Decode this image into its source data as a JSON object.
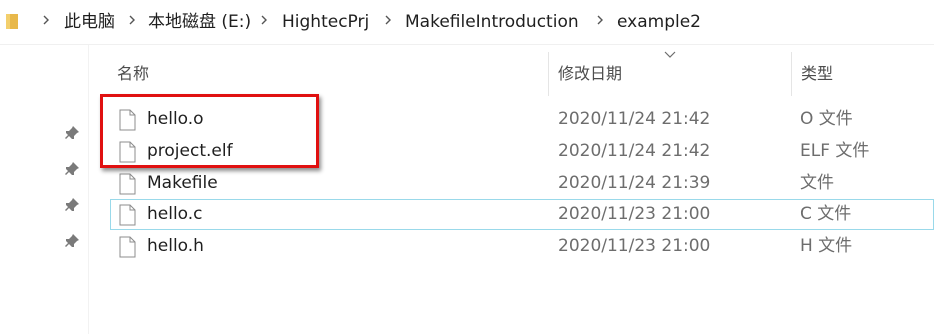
{
  "address_bar": {
    "crumbs": [
      "此电脑",
      "本地磁盘 (E:)",
      "HightecPrj",
      "MakefileIntroduction",
      "example2"
    ]
  },
  "columns": {
    "name": "名称",
    "date": "修改日期",
    "type": "类型"
  },
  "files": [
    {
      "name": "hello.o",
      "date": "2020/11/24 21:42",
      "type": "O 文件"
    },
    {
      "name": "project.elf",
      "date": "2020/11/24 21:42",
      "type": "ELF 文件"
    },
    {
      "name": "Makefile",
      "date": "2020/11/24 21:39",
      "type": "文件"
    },
    {
      "name": "hello.c",
      "date": "2020/11/23 21:00",
      "type": "C 文件"
    },
    {
      "name": "hello.h",
      "date": "2020/11/23 21:00",
      "type": "H 文件"
    }
  ],
  "colors": {
    "highlight_box": "#e01010",
    "focus_border": "#99d9ea",
    "folder": "#e8b84a"
  },
  "icons": {
    "folder": "folder-icon",
    "chevron": "chevron-right-icon",
    "pin": "pin-icon",
    "file": "file-icon",
    "sort": "sort-down-icon"
  }
}
